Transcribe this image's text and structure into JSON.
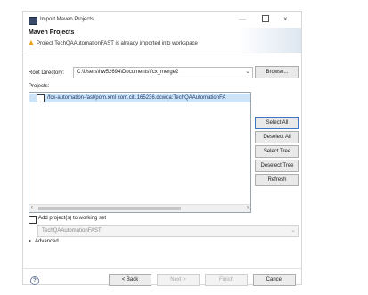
{
  "window": {
    "title": "Import Maven Projects",
    "controls": {
      "minimize": "—",
      "maximize": "☐",
      "close": "×"
    }
  },
  "header": {
    "title": "Maven Projects",
    "message": "Project TechQAAutomationFAST is already imported into workspace"
  },
  "root": {
    "label": "Root Directory:",
    "value": "C:\\Users\\hw52694\\Documents\\fcx_merge2",
    "browse_label": "Browse..."
  },
  "projects": {
    "label": "Projects:",
    "items": [
      {
        "label": "/fcx-automation-fast/pom.xml  com.citi.165236.dcwqa:TechQAAutomationFA",
        "checked": false
      }
    ]
  },
  "side_buttons": {
    "select_all": "Select All",
    "deselect_all": "Deselect All",
    "select_tree": "Select Tree",
    "deselect_tree": "Deselect Tree",
    "refresh": "Refresh"
  },
  "working_set": {
    "checkbox_label": "Add project(s) to working set",
    "value": "TechQAAutomationFAST"
  },
  "advanced": {
    "label": "Advanced"
  },
  "footer": {
    "back": "< Back",
    "next": "Next >",
    "finish": "Finish",
    "cancel": "Cancel"
  },
  "icons": {
    "help": "?",
    "warning": "warning-icon",
    "scroll_left": "‹",
    "scroll_right": "›",
    "combo_arrow": "⌄"
  },
  "colors": {
    "selection": "#cde3f7",
    "warning": "#e7a41a",
    "primary_border": "#3b78c4"
  }
}
